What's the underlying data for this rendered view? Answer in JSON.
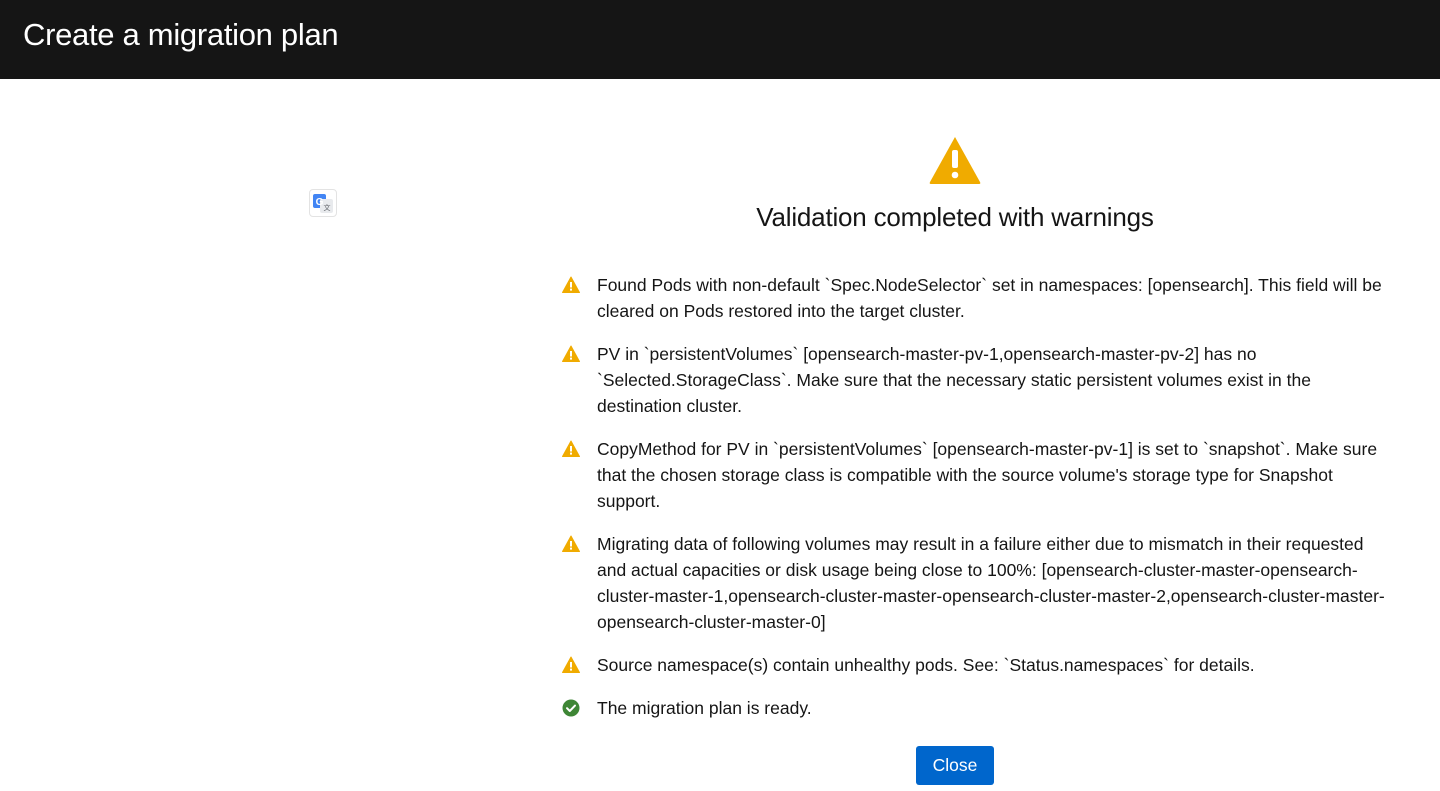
{
  "header": {
    "title": "Create a migration plan"
  },
  "translate": {
    "icon": "google-translate-icon",
    "label": "G"
  },
  "validation": {
    "status_icon": "warning-triangle-icon",
    "headline": "Validation completed with warnings",
    "messages": [
      {
        "type": "warning",
        "icon": "warning-icon",
        "text": "Found Pods with non-default `Spec.NodeSelector` set in namespaces: [opensearch]. This field will be cleared on Pods restored into the target cluster."
      },
      {
        "type": "warning",
        "icon": "warning-icon",
        "text": "PV in `persistentVolumes` [opensearch-master-pv-1,opensearch-master-pv-2] has no `Selected.StorageClass`. Make sure that the necessary static persistent volumes exist in the destination cluster."
      },
      {
        "type": "warning",
        "icon": "warning-icon",
        "text": "CopyMethod for PV in `persistentVolumes` [opensearch-master-pv-1] is set to `snapshot`. Make sure that the chosen storage class is compatible with the source volume's storage type for Snapshot support."
      },
      {
        "type": "warning",
        "icon": "warning-icon",
        "text": "Migrating data of following volumes may result in a failure either due to mismatch in their requested and actual capacities or disk usage being close to 100%: [opensearch-cluster-master-opensearch-cluster-master-1,opensearch-cluster-master-opensearch-cluster-master-2,opensearch-cluster-master-opensearch-cluster-master-0]"
      },
      {
        "type": "warning",
        "icon": "warning-icon",
        "text": "Source namespace(s) contain unhealthy pods. See: `Status.namespaces` for details."
      },
      {
        "type": "success",
        "icon": "check-circle-icon",
        "text": "The migration plan is ready."
      }
    ]
  },
  "actions": {
    "close_label": "Close"
  },
  "colors": {
    "header_bg": "#151515",
    "warning": "#f0ab00",
    "success": "#3e8635",
    "primary": "#0066cc"
  }
}
